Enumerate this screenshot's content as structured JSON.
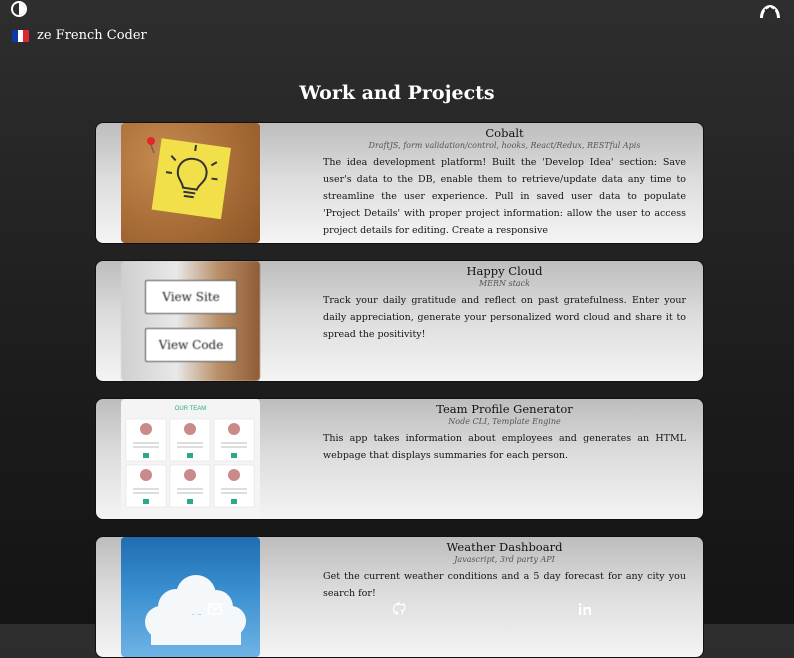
{
  "nav": {
    "brand_label": "ze French Coder",
    "theme_toggle_icon": "half-moon-toggle-icon",
    "profile_icon": "croissant-icon"
  },
  "page_title": "Work and Projects",
  "projects": [
    {
      "title": "Cobalt",
      "tech": "DraftJS, form validation/control, hooks, React/Redux, RESTful Apis",
      "description": "The idea development platform! Built the 'Develop Idea' section: Save user's data to the DB, enable them to retrieve/update data any time to streamline the user experience. Pull in saved user data to populate 'Project Details' with proper project information: allow the user to access project details for editing. Create a responsive"
    },
    {
      "title": "Happy Cloud",
      "tech": "MERN stack",
      "description": "Track your daily gratitude and reflect on past gratefulness. Enter your daily appreciation, generate your personalized word cloud and share it to spread the positivity!",
      "view_site_label": "View Site",
      "view_code_label": "View Code"
    },
    {
      "title": "Team Profile Generator",
      "tech": "Node CLI, Template Engine",
      "description": "This app takes information about employees and generates an HTML webpage that displays summaries for each person.",
      "thumb_heading": "OUR TEAM"
    },
    {
      "title": "Weather Dashboard",
      "tech": "Javascript, 3rd party API",
      "description": "Get the current weather conditions and a 5 day forecast for any city you search for!"
    }
  ],
  "footer": {
    "icons": [
      "mail-icon",
      "github-icon",
      "linkedin-icon"
    ]
  }
}
